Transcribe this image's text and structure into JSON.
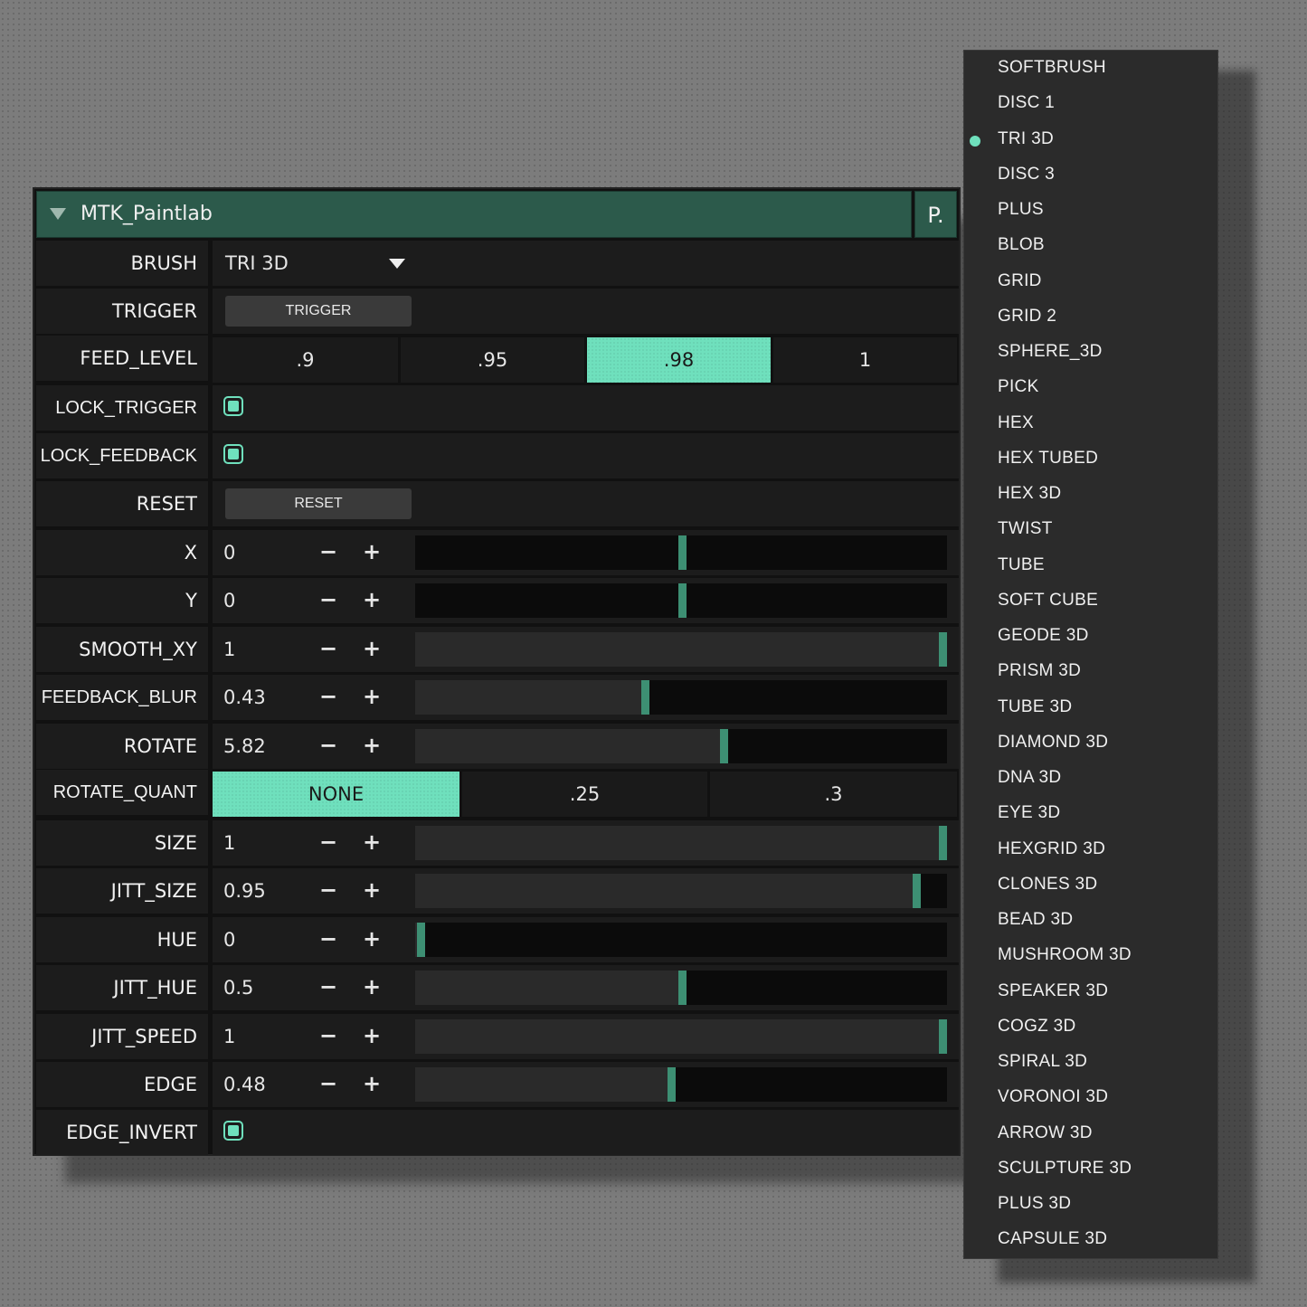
{
  "panel": {
    "title": "MTK_Paintlab",
    "preset_button": "P."
  },
  "rows": {
    "brush": {
      "label": "BRUSH",
      "value": "TRI 3D"
    },
    "trigger": {
      "label": "TRIGGER",
      "button": "TRIGGER"
    },
    "feed_level": {
      "label": "FEED_LEVEL",
      "options": [
        ".9",
        ".95",
        ".98",
        "1"
      ],
      "selected": ".98"
    },
    "lock_trigger": {
      "label": "LOCK_TRIGGER",
      "checked": true
    },
    "lock_feedback": {
      "label": "LOCK_FEEDBACK",
      "checked": true
    },
    "reset": {
      "label": "RESET",
      "button": "RESET"
    },
    "x": {
      "label": "X",
      "value": "0",
      "level": 0.5
    },
    "y": {
      "label": "Y",
      "value": "0",
      "level": 0.5
    },
    "smooth_xy": {
      "label": "SMOOTH_XY",
      "value": "1",
      "level": 1.0
    },
    "feedback_blur": {
      "label": "FEEDBACK_BLUR",
      "value": "0.43",
      "level": 0.43
    },
    "rotate": {
      "label": "ROTATE",
      "value": "5.82",
      "level": 0.58
    },
    "rotate_quant": {
      "label": "ROTATE_QUANT",
      "options": [
        "NONE",
        ".25",
        ".3"
      ],
      "selected": "NONE"
    },
    "size": {
      "label": "SIZE",
      "value": "1",
      "level": 1.0
    },
    "jitt_size": {
      "label": "JITT_SIZE",
      "value": "0.95",
      "level": 0.95
    },
    "hue": {
      "label": "HUE",
      "value": "0",
      "level": 0.0
    },
    "jitt_hue": {
      "label": "JITT_HUE",
      "value": "0.5",
      "level": 0.5
    },
    "jitt_speed": {
      "label": "JITT_SPEED",
      "value": "1",
      "level": 1.0
    },
    "edge": {
      "label": "EDGE",
      "value": "0.48",
      "level": 0.48
    },
    "edge_invert": {
      "label": "EDGE_INVERT",
      "checked": true
    }
  },
  "stepper": {
    "minus": "−",
    "plus": "+"
  },
  "menu": {
    "selected": "TRI 3D",
    "items": [
      "SOFTBRUSH",
      "DISC 1",
      "TRI 3D",
      "DISC 3",
      "PLUS",
      "BLOB",
      "GRID",
      "GRID 2",
      "SPHERE_3D",
      "PICK",
      "HEX",
      "HEX TUBED",
      "HEX 3D",
      "TWIST",
      "TUBE",
      "SOFT CUBE",
      "GEODE 3D",
      "PRISM 3D",
      "TUBE 3D",
      "DIAMOND 3D",
      "DNA 3D",
      "EYE 3D",
      "HEXGRID 3D",
      "CLONES 3D",
      "BEAD 3D",
      "MUSHROOM 3D",
      "SPEAKER 3D",
      "COGZ 3D",
      "SPIRAL 3D",
      "VORONOI 3D",
      "ARROW 3D",
      "SCULPTURE 3D",
      "PLUS 3D",
      "CAPSULE 3D"
    ]
  },
  "colors": {
    "accent": "#6fe0bd",
    "title_bar": "#2c5a4b",
    "handle": "#3d8f73"
  }
}
